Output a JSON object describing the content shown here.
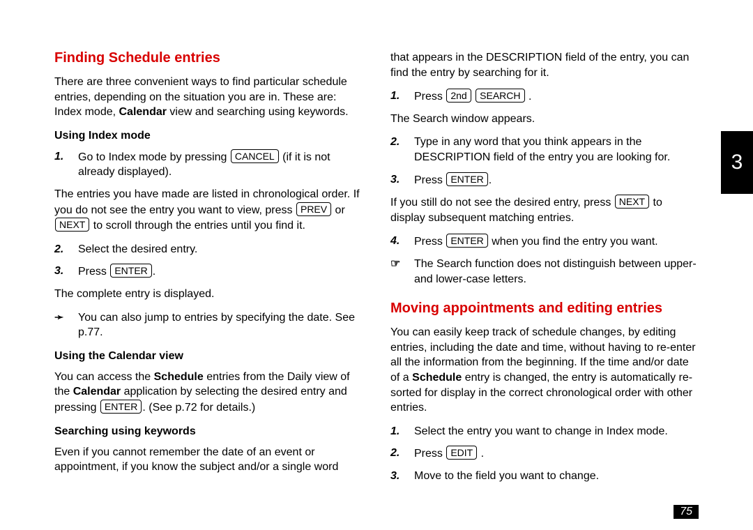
{
  "sidetab": "3",
  "pageno": "75",
  "left": {
    "h1": "Finding Schedule entries",
    "intro_a": "There are three convenient ways to find particular schedule entries, depending on the situation you are in. These are: Index mode, ",
    "intro_b_bold": "Calendar",
    "intro_c": " view and searching using keywords.",
    "sub1": "Using Index mode",
    "s1_a": "Go to Index mode by pressing ",
    "key_cancel": "CANCEL",
    "s1_b": " (if it is not already displayed).",
    "pA_a": "The entries you have made are listed in chronological order. If you do not see the entry you want to view, press ",
    "key_prev": "PREV",
    "pA_or": " or ",
    "key_next": "NEXT",
    "pA_b": " to scroll through the entries until you find it.",
    "s2": "Select the desired entry.",
    "s3_a": "Press ",
    "key_enter": "ENTER",
    "s3_b": ".",
    "pB": "The complete entry is displayed.",
    "tip": "You can also jump to entries by specifying the date. See p.77.",
    "sub2": "Using the Calendar view",
    "pC_a": "You can access the ",
    "pC_b_bold": "Schedule",
    "pC_c": " entries from the Daily view of the ",
    "pC_d_bold": "Calendar",
    "pC_e": " application by selecting the desired entry and pressing ",
    "pC_f": ". (See p.72 for details.)",
    "sub3": "Searching using keywords",
    "pD": "Even if you cannot remember the date of an event or appointment, if you know the subject and/or a single word"
  },
  "right": {
    "pE": "that appears in the DESCRIPTION field of the entry, you can find the entry by searching for it.",
    "r1_a": "Press ",
    "key_2nd": "2nd",
    "key_search": "SEARCH",
    "r1_b": " .",
    "pF": "The Search window appears.",
    "r2": "Type in any word that you think appears in the DESCRIPTION field of the entry you are looking for.",
    "r3_a": "Press ",
    "r3_b": ".",
    "pG_a": "If you still do not see the desired entry, press ",
    "pG_b": " to display subsequent matching entries.",
    "r4_a": "Press ",
    "r4_b": " when you find the entry you want.",
    "note": "The Search function does not distinguish between upper- and lower-case letters.",
    "h2": "Moving appointments and editing entries",
    "pH_a": "You can easily keep track of schedule changes, by editing entries, including the date and time, without having to re-enter all the information from the beginning. If the time and/or date of a ",
    "pH_b_bold": "Schedule",
    "pH_c": " entry is changed, the entry is automatically re-sorted for display in the correct chronological order with other entries.",
    "m1": "Select the entry you want to change in Index mode.",
    "m2_a": "Press ",
    "key_edit": "EDIT",
    "m2_b": " .",
    "m3": "Move to the field you want to change."
  }
}
